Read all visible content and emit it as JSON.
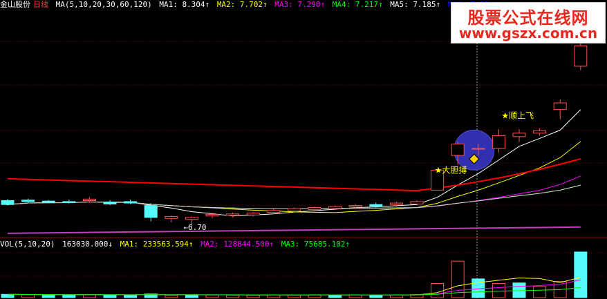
{
  "header": {
    "stock_name": "金山股份",
    "period": "日线",
    "ma_formula": "MA(5,10,20,30,60,120)",
    "ma1": "MA1: 8.304↑",
    "ma2": "MA2: 7.702↑",
    "ma3": "MA3: 7.290↑",
    "ma4": "MA4: 7.217↑",
    "ma5": "MA5: 7.185↑",
    "ma6": "MA6: 7.19"
  },
  "volume_header": {
    "formula": "VOL(5,10,20)",
    "value": "163030.000↓",
    "ma1": "MA1: 233563.594↑",
    "ma2": "MA2: 128844.500↑",
    "ma3": "MA3: 75685.102↑"
  },
  "watermark": {
    "title": "股票公式在线网",
    "url": "www.gszx.com.cn"
  },
  "colors": {
    "up": "#ff5050",
    "down": "#54fcfc",
    "ma1": "#ffffff",
    "ma2": "#ffff00",
    "ma3": "#ff00ff",
    "ma4": "#00ff00",
    "ma5": "#cfcfcf",
    "ma6": "#ff0000",
    "ma_long": "#c040c0",
    "header_white": "#ffffff",
    "header_yellow": "#ffff00",
    "header_magenta": "#ff00ff",
    "header_green": "#00ff00",
    "header_blue": "#0000ff",
    "name_red": "#ff4040"
  },
  "chart_data": {
    "type": "candlestick",
    "price_low_label": "6.70",
    "annotations": [
      {
        "text": "★大胆搏",
        "index": 21
      },
      {
        "text": "★顺上飞",
        "index": 24
      }
    ],
    "candles": [
      {
        "o": 7.24,
        "h": 7.27,
        "l": 7.14,
        "c": 7.16
      },
      {
        "o": 7.25,
        "h": 7.28,
        "l": 7.19,
        "c": 7.22
      },
      {
        "o": 7.23,
        "h": 7.25,
        "l": 7.19,
        "c": 7.21
      },
      {
        "o": 7.22,
        "h": 7.26,
        "l": 7.18,
        "c": 7.2
      },
      {
        "o": 7.24,
        "h": 7.31,
        "l": 7.19,
        "c": 7.27
      },
      {
        "o": 7.21,
        "h": 7.25,
        "l": 7.15,
        "c": 7.17
      },
      {
        "o": 7.22,
        "h": 7.26,
        "l": 7.17,
        "c": 7.19
      },
      {
        "o": 7.14,
        "h": 7.19,
        "l": 6.82,
        "c": 6.9
      },
      {
        "o": 6.88,
        "h": 6.94,
        "l": 6.8,
        "c": 6.92
      },
      {
        "o": 6.86,
        "h": 6.92,
        "l": 6.7,
        "c": 6.9
      },
      {
        "o": 6.93,
        "h": 6.99,
        "l": 6.88,
        "c": 6.96
      },
      {
        "o": 6.94,
        "h": 7.0,
        "l": 6.9,
        "c": 6.97
      },
      {
        "o": 6.95,
        "h": 7.01,
        "l": 6.92,
        "c": 6.99
      },
      {
        "o": 7.0,
        "h": 7.07,
        "l": 6.96,
        "c": 7.04
      },
      {
        "o": 7.03,
        "h": 7.1,
        "l": 7.0,
        "c": 7.08
      },
      {
        "o": 7.06,
        "h": 7.12,
        "l": 7.02,
        "c": 7.1
      },
      {
        "o": 7.08,
        "h": 7.14,
        "l": 7.05,
        "c": 7.12
      },
      {
        "o": 7.11,
        "h": 7.17,
        "l": 7.07,
        "c": 7.14
      },
      {
        "o": 7.16,
        "h": 7.2,
        "l": 7.09,
        "c": 7.13
      },
      {
        "o": 7.16,
        "h": 7.22,
        "l": 7.11,
        "c": 7.19
      },
      {
        "o": 7.17,
        "h": 7.25,
        "l": 7.14,
        "c": 7.22
      },
      {
        "o": 7.45,
        "h": 7.86,
        "l": 7.45,
        "c": 7.85
      },
      {
        "o": 8.15,
        "h": 8.43,
        "l": 7.96,
        "c": 8.38
      },
      {
        "o": 8.28,
        "h": 8.38,
        "l": 8.15,
        "c": 8.29
      },
      {
        "o": 8.29,
        "h": 8.68,
        "l": 8.2,
        "c": 8.55
      },
      {
        "o": 8.53,
        "h": 8.68,
        "l": 8.42,
        "c": 8.6
      },
      {
        "o": 8.6,
        "h": 8.7,
        "l": 8.55,
        "c": 8.65
      },
      {
        "o": 9.08,
        "h": 9.28,
        "l": 8.88,
        "c": 9.21
      },
      {
        "o": 9.95,
        "h": 10.44,
        "l": 9.87,
        "c": 10.36
      }
    ],
    "volume": [
      {
        "v": 32000,
        "up": false
      },
      {
        "v": 30000,
        "up": true
      },
      {
        "v": 28000,
        "up": false
      },
      {
        "v": 26000,
        "up": false
      },
      {
        "v": 29000,
        "up": true
      },
      {
        "v": 27000,
        "up": false
      },
      {
        "v": 25000,
        "up": false
      },
      {
        "v": 36000,
        "up": false
      },
      {
        "v": 23000,
        "up": true
      },
      {
        "v": 28000,
        "up": false
      },
      {
        "v": 26000,
        "up": true
      },
      {
        "v": 24000,
        "up": true
      },
      {
        "v": 25000,
        "up": true
      },
      {
        "v": 27000,
        "up": true
      },
      {
        "v": 26000,
        "up": true
      },
      {
        "v": 28000,
        "up": true
      },
      {
        "v": 24000,
        "up": false
      },
      {
        "v": 27000,
        "up": true
      },
      {
        "v": 25000,
        "up": false
      },
      {
        "v": 27000,
        "up": true
      },
      {
        "v": 30000,
        "up": true
      },
      {
        "v": 140000,
        "up": true
      },
      {
        "v": 360000,
        "up": true
      },
      {
        "v": 185000,
        "up": false
      },
      {
        "v": 140000,
        "up": true
      },
      {
        "v": 145000,
        "up": false
      },
      {
        "v": 110000,
        "up": true
      },
      {
        "v": 160000,
        "up": true
      },
      {
        "v": 450000,
        "up": false
      }
    ]
  }
}
